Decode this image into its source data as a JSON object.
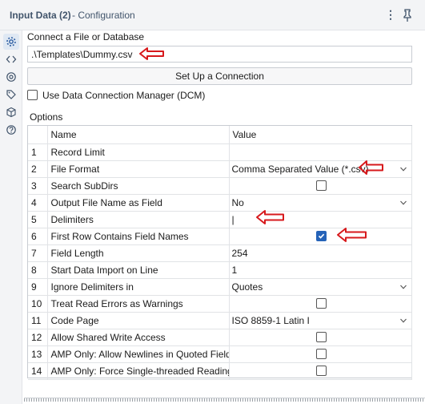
{
  "header": {
    "title": "Input Data (2)",
    "subtitle": "- Configuration"
  },
  "connect": {
    "label": "Connect a File or Database",
    "path_value": ".\\Templates\\Dummy.csv",
    "setup_button": "Set Up a Connection",
    "dcm_label": "Use Data Connection Manager (DCM)",
    "dcm_checked": false
  },
  "options": {
    "label": "Options",
    "columns": {
      "name": "Name",
      "value": "Value"
    },
    "rows": [
      {
        "num": "1",
        "name": "Record Limit",
        "type": "text",
        "value": ""
      },
      {
        "num": "2",
        "name": "File Format",
        "type": "select",
        "value": "Comma Separated Value (*.csv)"
      },
      {
        "num": "3",
        "name": "Search SubDirs",
        "type": "checkbox",
        "checked": false
      },
      {
        "num": "4",
        "name": "Output File Name as Field",
        "type": "select",
        "value": "No"
      },
      {
        "num": "5",
        "name": "Delimiters",
        "type": "text",
        "value": "|"
      },
      {
        "num": "6",
        "name": "First Row Contains Field Names",
        "type": "checkbox",
        "checked": true
      },
      {
        "num": "7",
        "name": "Field Length",
        "type": "text",
        "value": "254"
      },
      {
        "num": "8",
        "name": "Start Data Import on Line",
        "type": "text",
        "value": "1"
      },
      {
        "num": "9",
        "name": "Ignore Delimiters in",
        "type": "select",
        "value": "Quotes"
      },
      {
        "num": "10",
        "name": "Treat Read Errors as Warnings",
        "type": "checkbox",
        "checked": false
      },
      {
        "num": "11",
        "name": "Code Page",
        "type": "select",
        "value": "ISO 8859-1 Latin I"
      },
      {
        "num": "12",
        "name": "Allow Shared Write Access",
        "type": "checkbox",
        "checked": false
      },
      {
        "num": "13",
        "name": "AMP Only: Allow Newlines in Quoted Fields",
        "type": "checkbox",
        "checked": false
      },
      {
        "num": "14",
        "name": "AMP Only: Force Single-threaded Reading",
        "type": "checkbox",
        "checked": false
      }
    ]
  },
  "rail_icons": [
    "gear-icon",
    "code-icon",
    "settings-circle-icon",
    "tag-icon",
    "cube-icon",
    "help-icon"
  ],
  "colors": {
    "accent": "#2563b8",
    "annotation_arrow": "#d7191c",
    "header_text": "#41546b"
  }
}
